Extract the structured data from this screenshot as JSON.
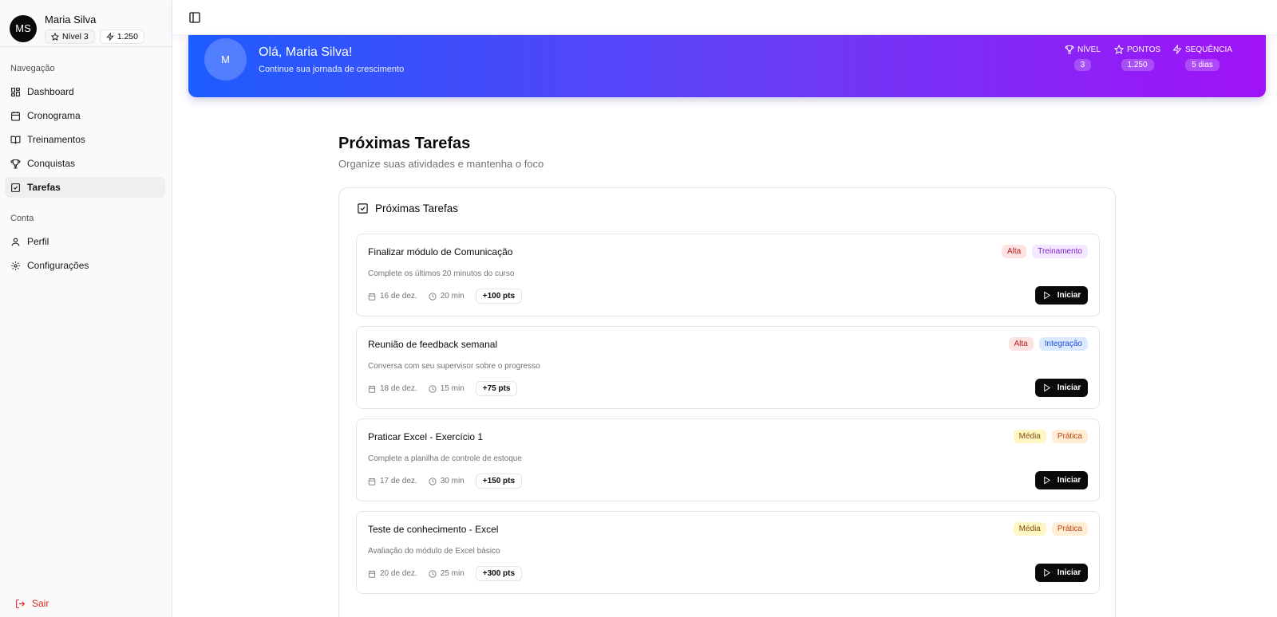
{
  "user": {
    "initials": "MS",
    "name": "Maria Silva",
    "level": "Nível 3",
    "points": "1.250"
  },
  "nav": {
    "section_label": "Navegação",
    "items": [
      {
        "label": "Dashboard",
        "icon": "dashboard-icon"
      },
      {
        "label": "Cronograma",
        "icon": "calendar-icon"
      },
      {
        "label": "Treinamentos",
        "icon": "book-icon"
      },
      {
        "label": "Conquistas",
        "icon": "trophy-icon"
      },
      {
        "label": "Tarefas",
        "icon": "checkbox-icon",
        "active": true
      }
    ]
  },
  "account": {
    "section_label": "Conta",
    "items": [
      {
        "label": "Perfil",
        "icon": "user-icon"
      },
      {
        "label": "Configurações",
        "icon": "gear-icon"
      }
    ],
    "logout_label": "Sair"
  },
  "hero": {
    "avatar_initial": "M",
    "greeting": "Olá, Maria Silva!",
    "subtitle": "Continue sua jornada de crescimento",
    "stats": [
      {
        "label": "NÍVEL",
        "value": "3",
        "icon": "trophy-icon"
      },
      {
        "label": "PONTOS",
        "value": "1.250",
        "icon": "star-icon"
      },
      {
        "label": "SEQUÊNCIA",
        "value": "5 dias",
        "icon": "zap-icon"
      }
    ]
  },
  "page": {
    "title": "Próximas Tarefas",
    "subtitle": "Organize suas atividades e mantenha o foco",
    "card_title": "Próximas Tarefas",
    "start_label": "Iniciar"
  },
  "tasks": [
    {
      "title": "Finalizar módulo de Comunicação",
      "description": "Complete os últimos 20 minutos do curso",
      "date": "16 de dez.",
      "duration": "20 min",
      "points": "+100 pts",
      "priority": "Alta",
      "category": "Treinamento"
    },
    {
      "title": "Reunião de feedback semanal",
      "description": "Conversa com seu supervisor sobre o progresso",
      "date": "18 de dez.",
      "duration": "15 min",
      "points": "+75 pts",
      "priority": "Alta",
      "category": "Integração"
    },
    {
      "title": "Praticar Excel - Exercício 1",
      "description": "Complete a planilha de controle de estoque",
      "date": "17 de dez.",
      "duration": "30 min",
      "points": "+150 pts",
      "priority": "Média",
      "category": "Prática"
    },
    {
      "title": "Teste de conhecimento - Excel",
      "description": "Avaliação do módulo de Excel básico",
      "date": "20 de dez.",
      "duration": "25 min",
      "points": "+300 pts",
      "priority": "Média",
      "category": "Prática"
    }
  ],
  "colors": {
    "hero_start": "#1d5cff",
    "hero_end": "#a012f7",
    "primary_button": "#0a0a0a",
    "logout": "#dc2626"
  }
}
